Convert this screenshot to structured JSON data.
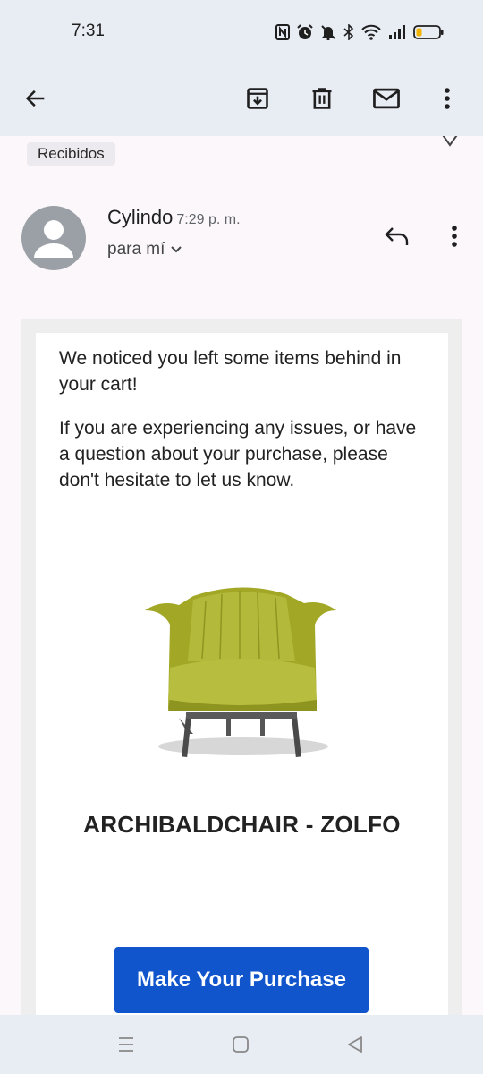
{
  "status_bar": {
    "time": "7:31",
    "icons": [
      "nfc-icon",
      "alarm-icon",
      "mute-icon",
      "bluetooth-icon",
      "wifi-icon",
      "signal-icon",
      "battery-icon"
    ]
  },
  "toolbar": {
    "icons": [
      "back-arrow-icon",
      "archive-icon",
      "delete-icon",
      "mark-unread-icon",
      "more-vert-icon"
    ]
  },
  "email": {
    "label": "Recibidos",
    "sender": "Cylindo",
    "time": "7:29 p. m.",
    "recipient": "para mí",
    "body": {
      "paragraph1": "We noticed you left some items behind in your cart!",
      "paragraph2": "If you are experiencing any issues, or have a question about your purchase, please don't hesitate to let us know.",
      "product_name": "ARCHIBALDCHAIR - ZOLFO",
      "cta_label": "Make Your Purchase"
    }
  },
  "nav_bar": {
    "icons": [
      "recents-icon",
      "home-icon",
      "back-icon"
    ]
  },
  "colors": {
    "cta": "#1155cc",
    "chrome": "#e8ecf3",
    "chair": "#a7ab2b"
  }
}
